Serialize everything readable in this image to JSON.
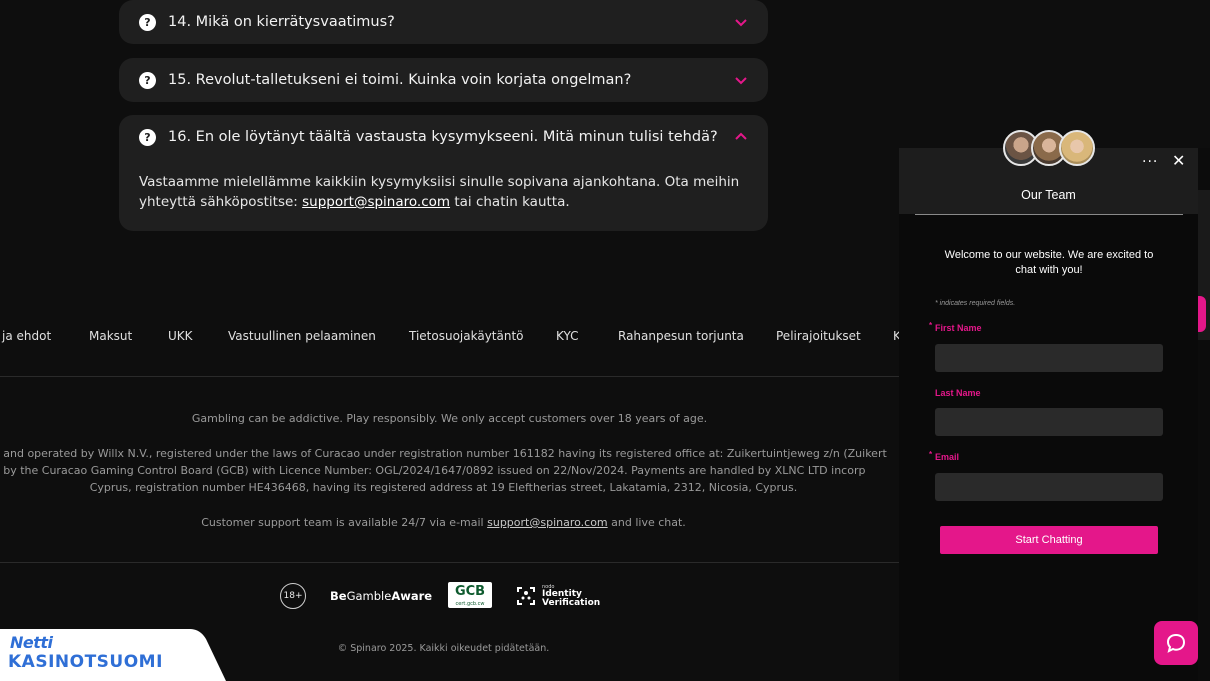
{
  "faq": {
    "q14": "14. Mikä on kierrätysvaatimus?",
    "q15": "15. Revolut-talletukseni ei toimi. Kuinka voin korjata ongelman?",
    "q16": "16. En ole löytänyt täältä vastausta kysymykseeni. Mitä minun tulisi tehdä?",
    "a16_part1": "Vastaamme mielellämme kaikkiin kysymyksiisi sinulle sopivana ajankohtana. Ota meihin yhteyttä sähköpostitse: ",
    "a16_link": "support@spinaro.com",
    "a16_part2": " tai chatin kautta.",
    "question_icon": "?"
  },
  "footer_nav": {
    "items": [
      "ja ehdot",
      "Maksut",
      "UKK",
      "Vastuullinen pelaaminen",
      "Tietosuojakäytäntö",
      "KYC",
      "Rahanpesun torjunta",
      "Pelirajoitukset",
      "K"
    ]
  },
  "footer": {
    "gambling_notice": "Gambling can be addictive. Play responsibly. We only accept customers over 18 years of age.",
    "legal_line1": "ed and operated by Willx N.V., registered under the laws of Curacao under registration number 161182 having its registered office at: Zuikertuintjeweg z/n (Zuikert",
    "legal_line2": "ed by the Curacao Gaming Control Board (GCB) with Licence Number: OGL/2024/1647/0892 issued on 22/Nov/2024. Payments are handled by XLNC LTD incorp",
    "legal_line3": "Cyprus, registration number HE436468, having its registered address at 19 Eleftherias street, Lakatamia, 2312, Nicosia, Cyprus.",
    "support_part1": "Customer support team is available 24/7 via e-mail ",
    "support_link": "support@spinaro.com",
    "support_part2": " and live chat.",
    "copyright": "© Spinaro 2025. Kaikki oikeudet pidätetään."
  },
  "badges": {
    "age": "18+",
    "gamble_aware_bold": "Be",
    "gamble_aware_mid": "Gamble",
    "gamble_aware_end": "Aware",
    "gcb": "GCB",
    "gcb_sub": "cert.gcb.cw",
    "idv_small": "nodo",
    "idv_line1": "Identity",
    "idv_line2": "Verification"
  },
  "logo": {
    "line1": "Netti",
    "line2": "KASINOTSUOMI"
  },
  "chat": {
    "title": "Our Team",
    "more_icon": "···",
    "close_icon": "✕",
    "welcome": "Welcome to our website. We are excited to chat with you!",
    "required_note": "* indicates required fields.",
    "first_name_label": "First Name",
    "last_name_label": "Last Name",
    "email_label": "Email",
    "required_star": "*",
    "start_button": "Start Chatting",
    "accent": "#e4178a"
  }
}
